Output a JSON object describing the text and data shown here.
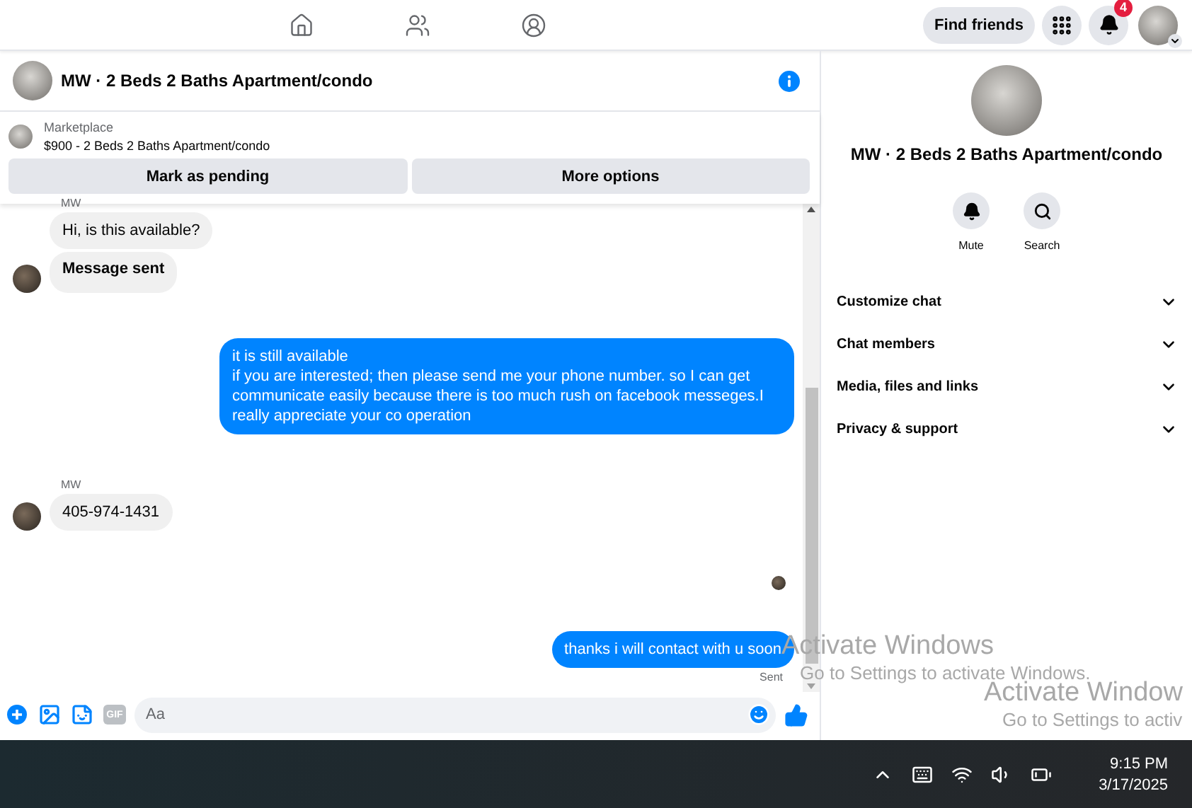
{
  "top_bar": {
    "find_friends": "Find friends",
    "notification_count": "4"
  },
  "chat": {
    "title": "MW · 2 Beds 2 Baths Apartment/condo",
    "listing": {
      "source": "Marketplace",
      "summary": "$900 - 2 Beds 2 Baths Apartment/condo"
    },
    "buttons": [
      "Mark as pending",
      "More options"
    ],
    "groups": [
      {
        "kind": "incoming",
        "sender": "MW",
        "messages": [
          {
            "text": "Hi, is this available?",
            "bold": false
          },
          {
            "text": "Message sent",
            "bold": true
          }
        ]
      },
      {
        "kind": "outgoing",
        "messages": [
          {
            "text": "it is still available\nif you are interested; then please send me your phone number. so I can get communicate easily because there is too much rush on facebook messeges.I really appreciate your co operation",
            "bold": false
          }
        ]
      },
      {
        "kind": "incoming",
        "sender": "MW",
        "seen": true,
        "messages": [
          {
            "text": "405-974-1431",
            "bold": false
          }
        ]
      },
      {
        "kind": "outgoing",
        "status": "Sent",
        "messages": [
          {
            "text": "thanks i will contact with u soon",
            "bold": false
          }
        ]
      }
    ],
    "composer": {
      "gif_label": "GIF",
      "placeholder": "Aa"
    }
  },
  "details": {
    "title": "MW · 2 Beds 2 Baths Apartment/condo",
    "actions": [
      {
        "kind": "mute",
        "label": "Mute"
      },
      {
        "kind": "search",
        "label": "Search"
      }
    ],
    "sections": [
      {
        "label": "Customize chat",
        "expanded": false
      },
      {
        "label": "Chat members",
        "expanded": false
      },
      {
        "label": "Media, files and links",
        "expanded": false
      },
      {
        "label": "Privacy & support",
        "expanded": false
      }
    ]
  },
  "taskbar": {
    "time": "9:15 PM",
    "date": "3/17/2025"
  },
  "activation_notices": [
    {
      "title": "Activate Windows",
      "subtitle": "Go to Settings to activate Windows."
    },
    {
      "title": "Activate Window",
      "subtitle": "Go to Settings to activ"
    }
  ]
}
